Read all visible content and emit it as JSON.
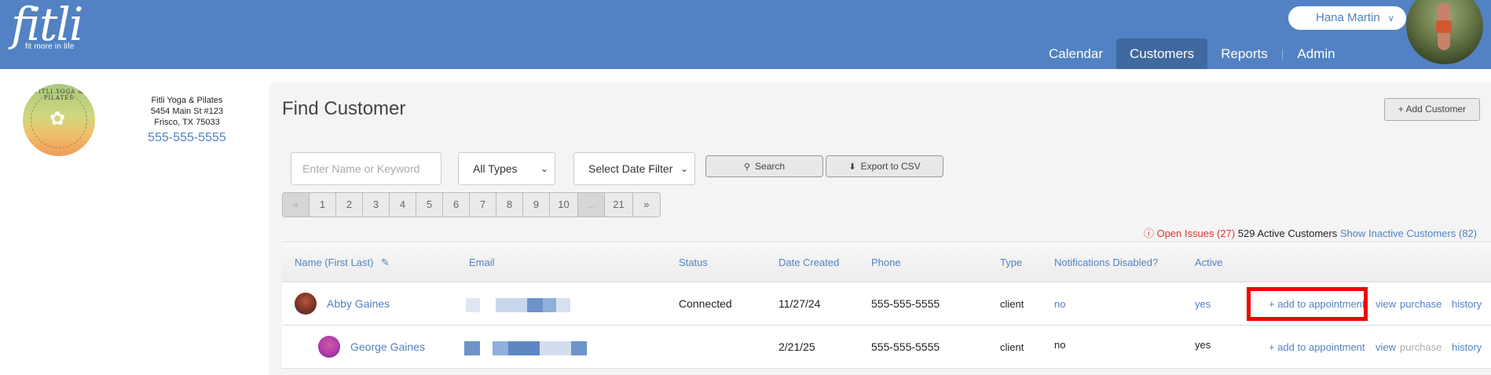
{
  "brand": {
    "logo_text": "fitli",
    "tagline": "fit more in life"
  },
  "user": {
    "name": "Hana Martin",
    "chevron": "chevron-down-icon"
  },
  "nav": {
    "items": [
      "Calendar",
      "Customers",
      "Reports",
      "Admin"
    ],
    "active": "Customers"
  },
  "studio": {
    "logo_text": "FITLI YOGA & PILATES",
    "name": "Fitli Yoga & Pilates",
    "address1": "5454 Main St #123",
    "address2": "Frisco, TX 75033",
    "phone": "555-555-5555"
  },
  "main": {
    "title": "Find Customer",
    "add_button": "+ Add Customer",
    "search_placeholder": "Enter Name or Keyword",
    "type_select": "All Types",
    "date_select": "Select Date Filter",
    "search_button": "Search",
    "export_button": "Export to CSV",
    "pager": [
      "«",
      "1",
      "2",
      "3",
      "4",
      "5",
      "6",
      "7",
      "8",
      "9",
      "10",
      "...",
      "21",
      "»"
    ],
    "summary": {
      "open_issues": "Open Issues (27)",
      "active": "529 Active Customers",
      "inactive_link": "Show Inactive Customers (82)"
    },
    "columns": [
      "Name (First Last)",
      "Email",
      "Status",
      "Date Created",
      "Phone",
      "Type",
      "Notifications Disabled?",
      "Active"
    ],
    "rows": [
      {
        "name": "Abby Gaines",
        "status": "Connected",
        "date_created": "11/27/24",
        "phone": "555-555-5555",
        "type": "client",
        "notifications_disabled": "no",
        "active": "yes",
        "actions": {
          "add": "+ add to appointment",
          "view": "view",
          "purchase": "purchase",
          "history": "history"
        }
      },
      {
        "name": "George Gaines",
        "status": "",
        "date_created": "2/21/25",
        "phone": "555-555-5555",
        "type": "client",
        "notifications_disabled": "no",
        "active": "yes",
        "actions": {
          "add": "+ add to appointment",
          "view": "view",
          "purchase": "purchase",
          "history": "history"
        }
      }
    ]
  },
  "colors": {
    "header": "#5282c3",
    "active_tab": "#3f699f",
    "link": "#5282c3",
    "highlight": "#ee0000"
  }
}
